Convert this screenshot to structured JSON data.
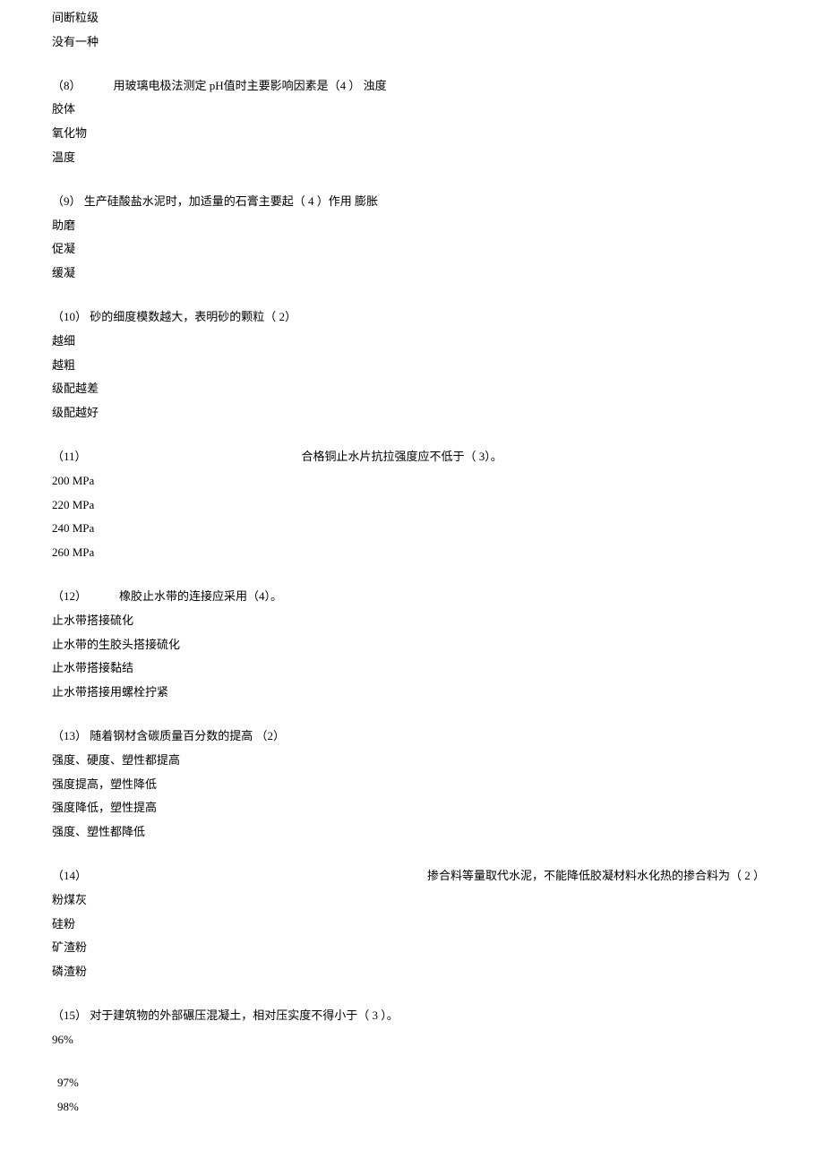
{
  "intro_lines": [
    "间断粒级",
    "没有一种"
  ],
  "questions": [
    {
      "number": "（8）",
      "gap_class": "wide-gap1",
      "stem": "用玻璃电极法测定 pH值时主要影响因素是（4 ）  浊度",
      "options": [
        "胶体",
        "氧化物",
        "温度"
      ]
    },
    {
      "number": "（9）",
      "gap_class": "",
      "stem": " 生产硅酸盐水泥时，加适量的石膏主要起（  4 ）作用 膨胀",
      "options": [
        "助磨",
        "促凝",
        "缓凝"
      ]
    },
    {
      "number": "（10）",
      "gap_class": "",
      "stem": " 砂的细度模数越大，表明砂的颗粒（  2）",
      "options": [
        "越细",
        "越粗",
        "级配越差",
        "级配越好"
      ]
    },
    {
      "number": "（11）",
      "gap_class": "wide-gap2",
      "stem": "合格铜止水片抗拉强度应不低于（  3）。",
      "options": [
        "200 MPa",
        "220 MPa",
        "240 MPa",
        "260 MPa"
      ]
    },
    {
      "number": "（12）",
      "gap_class": "wide-gap1",
      "stem": "橡胶止水带的连接应采用（4）。",
      "options": [
        "止水带搭接硫化",
        "止水带的生胶头搭接硫化",
        "止水带搭接黏结",
        "止水带搭接用螺栓拧紧"
      ]
    },
    {
      "number": "（13）",
      "gap_class": "",
      "stem": " 随着钢材含碳质量百分数的提高   （2）",
      "options": [
        "强度、硬度、塑性都提高",
        "强度提高，塑性降低",
        "强度降低，塑性提高",
        "强度、塑性都降低"
      ]
    },
    {
      "number": "（14）",
      "gap_class": "",
      "stem_prefix_wide": true,
      "stem": "掺合料等量取代水泥，不能降低胶凝材料水化热的掺合料为（ 2 ）",
      "options": [
        "粉煤灰",
        "硅粉",
        "矿渣粉",
        "磷渣粉"
      ]
    },
    {
      "number": "（15）",
      "gap_class": "",
      "stem": " 对于建筑物的外部碾压混凝土，相对压实度不得小于（    3 ）。",
      "options": [
        "96%"
      ],
      "tail_options": [
        "97%",
        "98%"
      ]
    }
  ]
}
